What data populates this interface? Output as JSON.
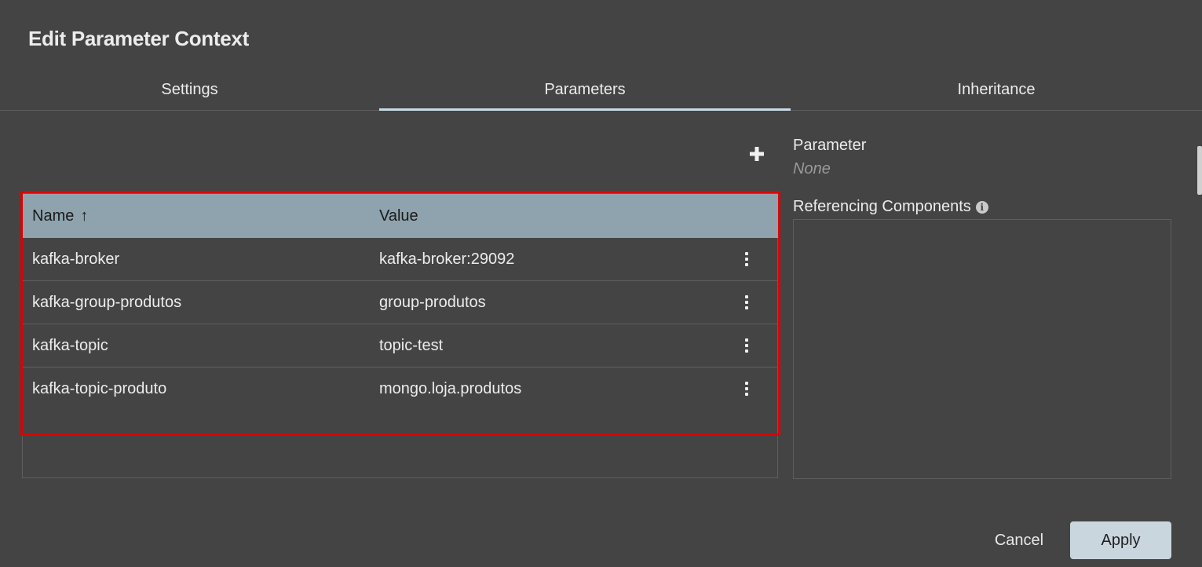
{
  "dialog": {
    "title": "Edit Parameter Context"
  },
  "tabs": [
    {
      "label": "Settings",
      "active": false
    },
    {
      "label": "Parameters",
      "active": true
    },
    {
      "label": "Inheritance",
      "active": false
    }
  ],
  "toolbar": {
    "add_icon": "plus-icon"
  },
  "table": {
    "columns": [
      {
        "label": "Name",
        "sort": "ascending",
        "sort_icon": "↑"
      },
      {
        "label": "Value"
      }
    ],
    "rows": [
      {
        "name": "kafka-broker",
        "value": "kafka-broker:29092"
      },
      {
        "name": "kafka-group-produtos",
        "value": "group-produtos"
      },
      {
        "name": "kafka-topic",
        "value": "topic-test"
      },
      {
        "name": "kafka-topic-produto",
        "value": "mongo.loja.produtos"
      }
    ],
    "highlight_color": "#e00000",
    "header_color": "#8ea3ad"
  },
  "side_panel": {
    "parameter_label": "Parameter",
    "parameter_value": "None",
    "referencing_label": "Referencing Components",
    "info_icon": "info-icon"
  },
  "footer": {
    "cancel_label": "Cancel",
    "apply_label": "Apply"
  },
  "colors": {
    "background": "#444444",
    "accent": "#c9dbe6",
    "apply_button": "#c9d6dd"
  }
}
